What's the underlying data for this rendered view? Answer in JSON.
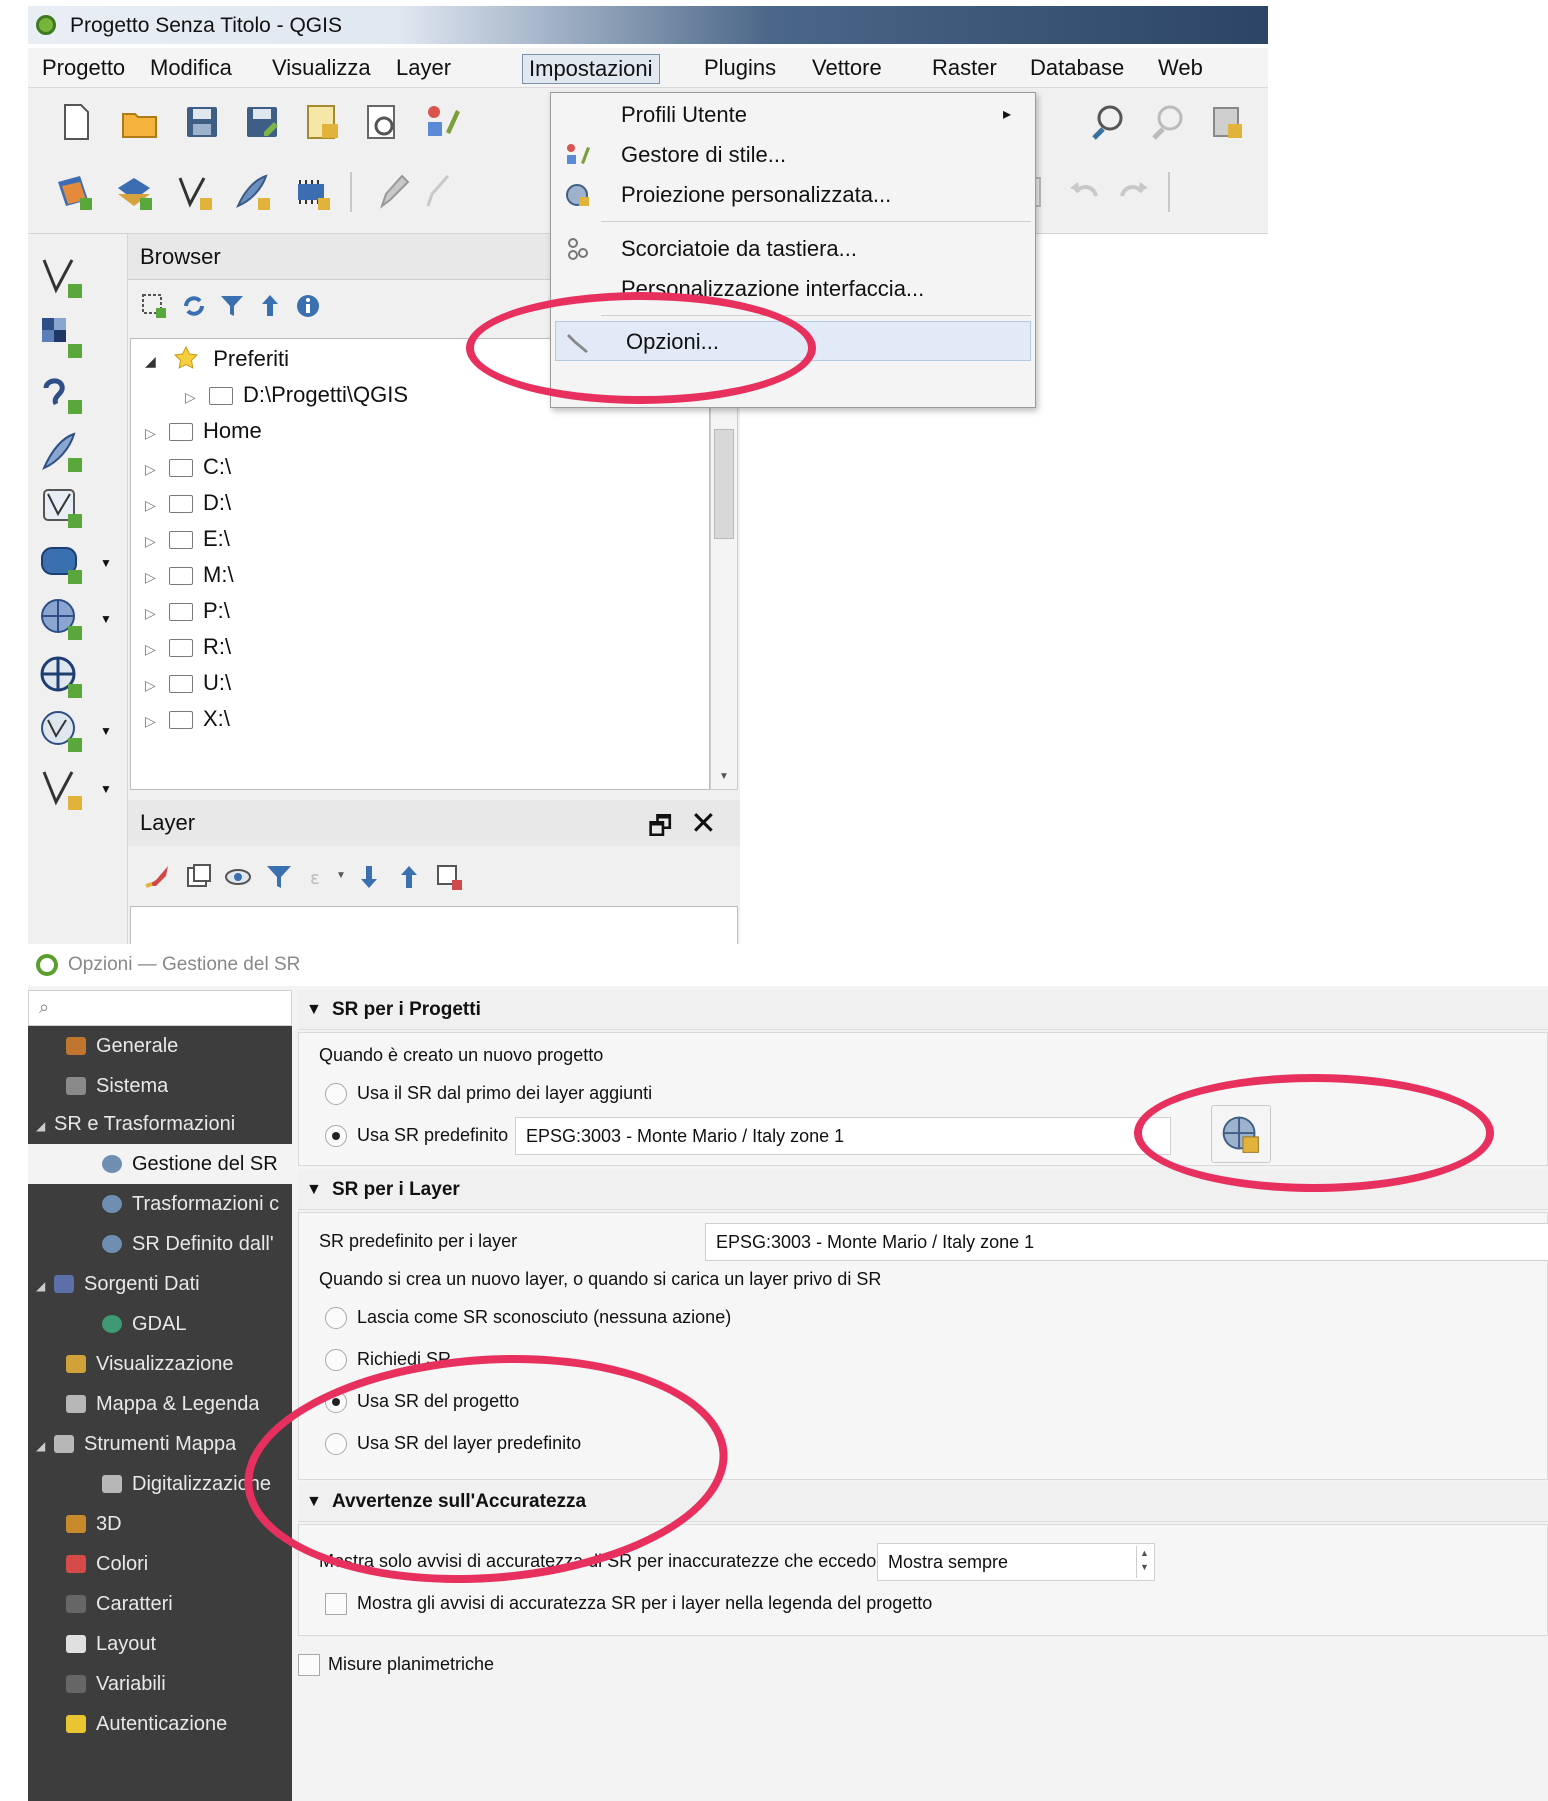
{
  "qgis": {
    "title": "Progetto Senza Titolo - QGIS",
    "menus": [
      "Progetto",
      "Modifica",
      "Visualizza",
      "Layer",
      "Impostazioni",
      "Plugins",
      "Vettore",
      "Raster",
      "Database",
      "Web"
    ],
    "active_menu": "Impostazioni",
    "settings_menu": {
      "items": [
        {
          "label": "Profili Utente",
          "icon": "user-profiles-icon",
          "submenu": true
        },
        {
          "label": "Gestore di stile...",
          "icon": "style-manager-icon"
        },
        {
          "label": "Proiezione personalizzata...",
          "icon": "custom-projection-icon"
        },
        {
          "label": "Scorciatoie da tastiera...",
          "icon": "keyboard-shortcuts-icon"
        },
        {
          "label": "Personalizzazione interfaccia...",
          "icon": "interface-customization-icon"
        },
        {
          "label": "Opzioni...",
          "icon": "wrench-icon"
        }
      ],
      "submenu_arrow": "▸"
    },
    "browser_panel": {
      "title": "Browser",
      "favorites_label": "Preferiti",
      "favorite_path": "D:\\Progetti\\QGIS",
      "home_label": "Home",
      "drives": [
        "C:\\",
        "D:\\",
        "E:\\",
        "M:\\",
        "P:\\",
        "R:\\",
        "U:\\",
        "X:\\"
      ]
    },
    "layer_panel": {
      "title": "Layer",
      "float_glyph": "🗗",
      "close_glyph": "✕"
    }
  },
  "options": {
    "title": "Opzioni — Gestione del SR",
    "search_icon": "⌕",
    "sidebar": [
      {
        "label": "Generale",
        "level": 0,
        "icon_color": "#c0762f"
      },
      {
        "label": "Sistema",
        "level": 0,
        "icon_color": "#8a8a8a"
      },
      {
        "label": "SR e Trasformazioni",
        "level": 0,
        "expandable": true
      },
      {
        "label": "Gestione del SR",
        "level": 1,
        "selected": true,
        "icon_color": "#6e8fb0"
      },
      {
        "label": "Trasformazioni c",
        "level": 1,
        "icon_color": "#6e8fb0"
      },
      {
        "label": "SR Definito dall'",
        "level": 1,
        "icon_color": "#6e8fb0"
      },
      {
        "label": "Sorgenti Dati",
        "level": 0,
        "expandable": true,
        "icon_color": "#5c6fa8"
      },
      {
        "label": "GDAL",
        "level": 1,
        "icon_color": "#3f9a73"
      },
      {
        "label": "Visualizzazione",
        "level": 0,
        "icon_color": "#d2a23a"
      },
      {
        "label": "Mappa & Legenda",
        "level": 0,
        "icon_color": "#b7b7b7"
      },
      {
        "label": "Strumenti Mappa",
        "level": 0,
        "expandable": true,
        "icon_color": "#b7b7b7"
      },
      {
        "label": "Digitalizzazione",
        "level": 1,
        "icon_color": "#b7b7b7"
      },
      {
        "label": "3D",
        "level": 0,
        "icon_color": "#c98a2d"
      },
      {
        "label": "Colori",
        "level": 0,
        "icon_color": "#d64a4a"
      },
      {
        "label": "Caratteri",
        "level": 0,
        "icon_color": "#666666"
      },
      {
        "label": "Layout",
        "level": 0,
        "icon_color": "#e0e0e0"
      },
      {
        "label": "Variabili",
        "level": 0,
        "icon_color": "#666666"
      },
      {
        "label": "Autenticazione",
        "level": 0,
        "icon_color": "#e8c531"
      }
    ],
    "project_crs": {
      "header": "SR per i Progetti",
      "when_new": "Quando è creato un nuovo progetto",
      "opt_first_layer": "Usa il SR dal primo dei layer aggiunti",
      "opt_default": "Usa SR predefinito",
      "default_value": "EPSG:3003 - Monte Mario / Italy zone 1",
      "selected": "default"
    },
    "layer_crs": {
      "header": "SR per i Layer",
      "default_label": "SR predefinito per i layer",
      "default_value": "EPSG:3003 - Monte Mario / Italy zone 1",
      "when_new": "Quando si crea un nuovo layer, o quando si carica un layer privo di SR",
      "opt_leave": "Lascia come SR sconosciuto (nessuna azione)",
      "opt_prompt": "Richiedi SR",
      "opt_project": "Usa SR del progetto",
      "opt_default": "Usa SR del layer predefinito",
      "selected": "project"
    },
    "accuracy": {
      "header": "Avvertenze sull'Accuratezza",
      "show_label": "Mostra solo avvisi di accuratezza di SR per inaccuratezze che eccedono",
      "show_value": "Mostra sempre",
      "legend_label": "Mostra gli avvisi di accuratezza SR per i layer nella legenda del progetto"
    },
    "planimetric_label": "Misure planimetriche"
  }
}
